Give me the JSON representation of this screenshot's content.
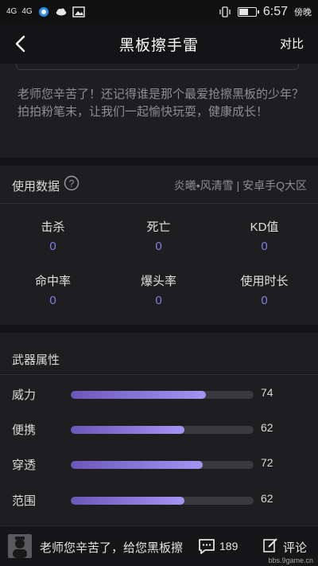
{
  "status_bar": {
    "signal1": "4G",
    "signal2": "4G",
    "time": "6:57",
    "period": "傍晚",
    "battery_level": 0.6
  },
  "nav": {
    "title": "黑板擦手雷",
    "compare_label": "对比"
  },
  "description": "老师您辛苦了！还记得谁是那个最爱抢擦黑板的少年？拍拍粉笔末，让我们一起愉快玩耍，健康成长！",
  "usage": {
    "title": "使用数据",
    "account": "炎曦•风清雪 | 安卓手Q大区",
    "stats": [
      {
        "label": "击杀",
        "value": "0"
      },
      {
        "label": "死亡",
        "value": "0"
      },
      {
        "label": "KD值",
        "value": "0"
      },
      {
        "label": "命中率",
        "value": "0"
      },
      {
        "label": "爆头率",
        "value": "0"
      },
      {
        "label": "使用时长",
        "value": "0"
      }
    ]
  },
  "weapon": {
    "title": "武器属性",
    "max_value": 100,
    "attributes": [
      {
        "label": "威力",
        "value": "74"
      },
      {
        "label": "便携",
        "value": "62"
      },
      {
        "label": "穿透",
        "value": "72"
      },
      {
        "label": "范围",
        "value": "62"
      }
    ]
  },
  "bottom_bar": {
    "input_text": "老师您辛苦了，给您黑板擦",
    "comment_count": "189",
    "comment_label": "评论"
  },
  "watermark": {
    "url": "bbs.9game.cn"
  },
  "colors": {
    "accent": "#7f7fe6",
    "bar_fill_start": "#6a57b8",
    "bar_fill_end": "#a594f2",
    "background": "#1e1e20"
  }
}
